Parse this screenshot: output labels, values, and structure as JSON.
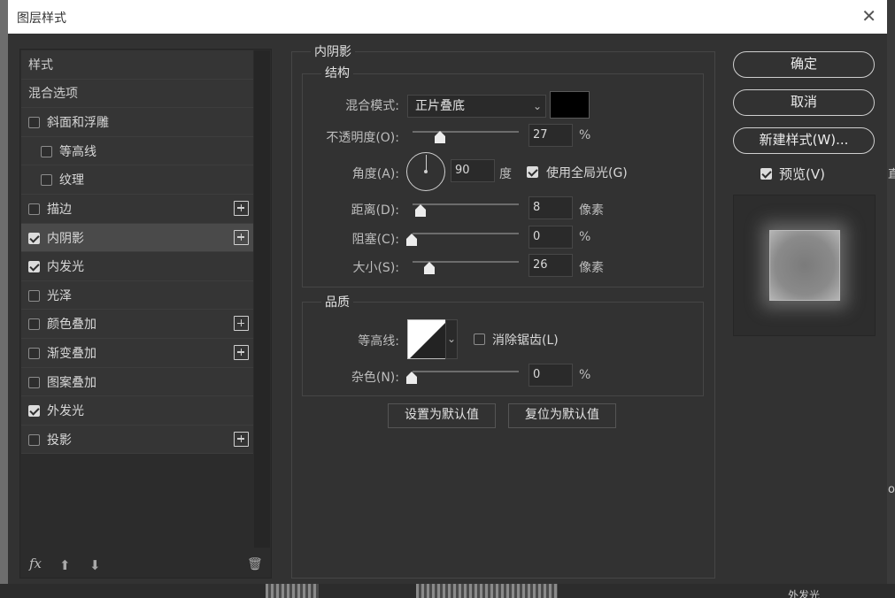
{
  "window": {
    "title": "图层样式",
    "close_glyph": "✕"
  },
  "background": {
    "fragment_1": "直",
    "fragment_2": "o",
    "fragment_3": "外发光"
  },
  "styles_list": {
    "items": [
      {
        "label": "样式",
        "type": "header"
      },
      {
        "label": "混合选项",
        "type": "header"
      },
      {
        "label": "斜面和浮雕",
        "checked": false,
        "indent": 0,
        "plus": false
      },
      {
        "label": "等高线",
        "checked": false,
        "indent": 1,
        "plus": false
      },
      {
        "label": "纹理",
        "checked": false,
        "indent": 1,
        "plus": false
      },
      {
        "label": "描边",
        "checked": false,
        "indent": 0,
        "plus": true
      },
      {
        "label": "内阴影",
        "checked": true,
        "indent": 0,
        "plus": true,
        "selected": true
      },
      {
        "label": "内发光",
        "checked": true,
        "indent": 0,
        "plus": false
      },
      {
        "label": "光泽",
        "checked": false,
        "indent": 0,
        "plus": false
      },
      {
        "label": "颜色叠加",
        "checked": false,
        "indent": 0,
        "plus": true
      },
      {
        "label": "渐变叠加",
        "checked": false,
        "indent": 0,
        "plus": true
      },
      {
        "label": "图案叠加",
        "checked": false,
        "indent": 0,
        "plus": false
      },
      {
        "label": "外发光",
        "checked": true,
        "indent": 0,
        "plus": false
      },
      {
        "label": "投影",
        "checked": false,
        "indent": 0,
        "plus": true
      }
    ],
    "tools": {
      "fx": "fx",
      "up": "⬆",
      "down": "⬇",
      "trash": "🗑"
    }
  },
  "inner_shadow": {
    "section_title": "内阴影",
    "structure": {
      "title": "结构",
      "blend_mode_label": "混合模式:",
      "blend_mode_value": "正片叠底",
      "color": "#000000",
      "opacity_label": "不透明度(O):",
      "opacity_value": "27",
      "opacity_unit": "%",
      "angle_label": "角度(A):",
      "angle_value": "90",
      "angle_unit": "度",
      "global_light_label": "使用全局光(G)",
      "global_light_checked": true,
      "distance_label": "距离(D):",
      "distance_value": "8",
      "distance_unit": "像素",
      "choke_label": "阻塞(C):",
      "choke_value": "0",
      "choke_unit": "%",
      "size_label": "大小(S):",
      "size_value": "26",
      "size_unit": "像素"
    },
    "quality": {
      "title": "品质",
      "contour_label": "等高线:",
      "antialias_label": "消除锯齿(L)",
      "antialias_checked": false,
      "noise_label": "杂色(N):",
      "noise_value": "0",
      "noise_unit": "%"
    },
    "set_default_label": "设置为默认值",
    "reset_default_label": "复位为默认值"
  },
  "actions": {
    "ok_label": "确定",
    "cancel_label": "取消",
    "new_style_label": "新建样式(W)...",
    "preview_label": "预览(V)",
    "preview_checked": true
  },
  "colors": {
    "dialog_bg": "#323232",
    "panel_bg": "#2c2c2c",
    "selected_bg": "#4a4a4a",
    "text": "#d6d6d6"
  }
}
